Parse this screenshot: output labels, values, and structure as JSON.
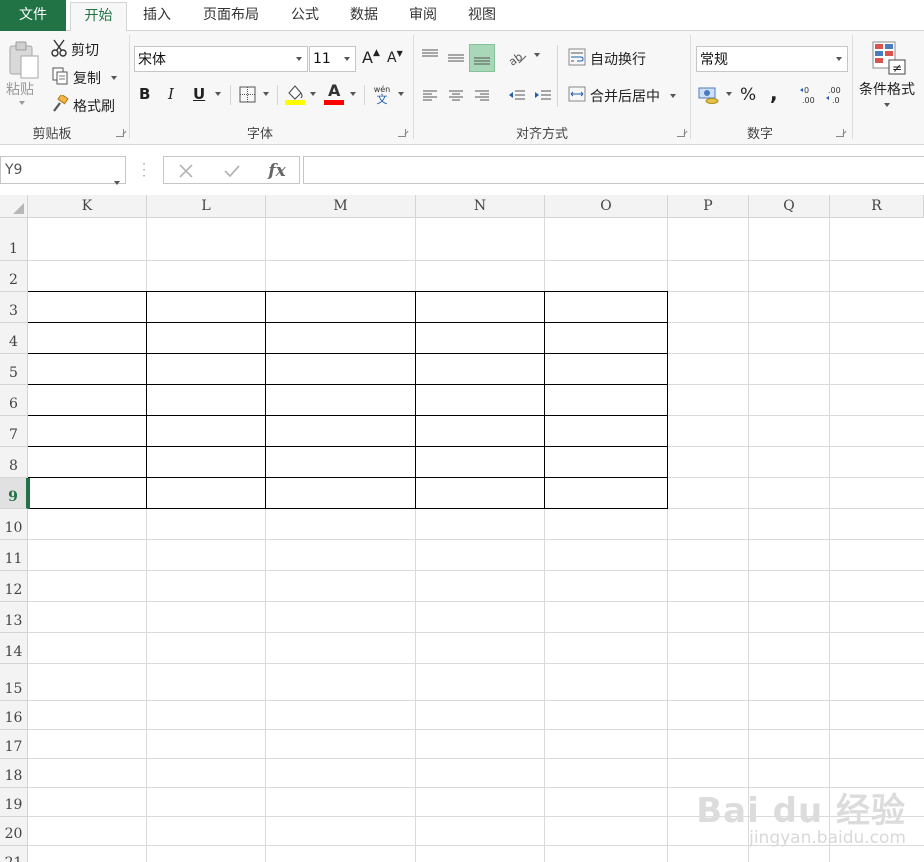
{
  "tabs": [
    {
      "label": "文件",
      "name": "tab-file"
    },
    {
      "label": "开始",
      "name": "tab-home"
    },
    {
      "label": "插入",
      "name": "tab-insert"
    },
    {
      "label": "页面布局",
      "name": "tab-page-layout"
    },
    {
      "label": "公式",
      "name": "tab-formulas"
    },
    {
      "label": "数据",
      "name": "tab-data"
    },
    {
      "label": "审阅",
      "name": "tab-review"
    },
    {
      "label": "视图",
      "name": "tab-view"
    }
  ],
  "clipboard": {
    "paste_label": "粘贴",
    "cut_label": "剪切",
    "copy_label": "复制",
    "format_painter_label": "格式刷",
    "group_label": "剪贴板"
  },
  "font": {
    "font_name": "宋体",
    "font_size": "11",
    "group_label": "字体",
    "bold": "B",
    "italic": "I",
    "underline": "U",
    "grow": "A",
    "shrink": "A",
    "font_color_letter": "A",
    "phonetic_top": "wén",
    "phonetic_bottom": "文",
    "fill_color": "#ffff00",
    "font_color": "#ff0000"
  },
  "alignment": {
    "wrap_text_label": "自动换行",
    "merge_center_label": "合并后居中",
    "group_label": "对齐方式"
  },
  "number": {
    "format": "常规",
    "percent": "%",
    "comma": ",",
    "group_label": "数字"
  },
  "styles": {
    "conditional_format_label": "条件格式"
  },
  "formula_bar": {
    "name_box": "Y9",
    "fx": "fx",
    "value": ""
  },
  "sheet": {
    "columns": [
      "K",
      "L",
      "M",
      "N",
      "O",
      "P",
      "Q",
      "R"
    ],
    "rows": [
      "1",
      "2",
      "3",
      "4",
      "5",
      "6",
      "7",
      "8",
      "9",
      "10",
      "11",
      "12",
      "13",
      "14",
      "15",
      "16",
      "17",
      "18",
      "19",
      "20",
      "21"
    ],
    "active_row": "9",
    "bordered_range": "K3:O9"
  },
  "watermark": {
    "main": "Bai du 经验",
    "sub": "jingyan.baidu.com"
  },
  "colors": {
    "accent": "#217346"
  }
}
